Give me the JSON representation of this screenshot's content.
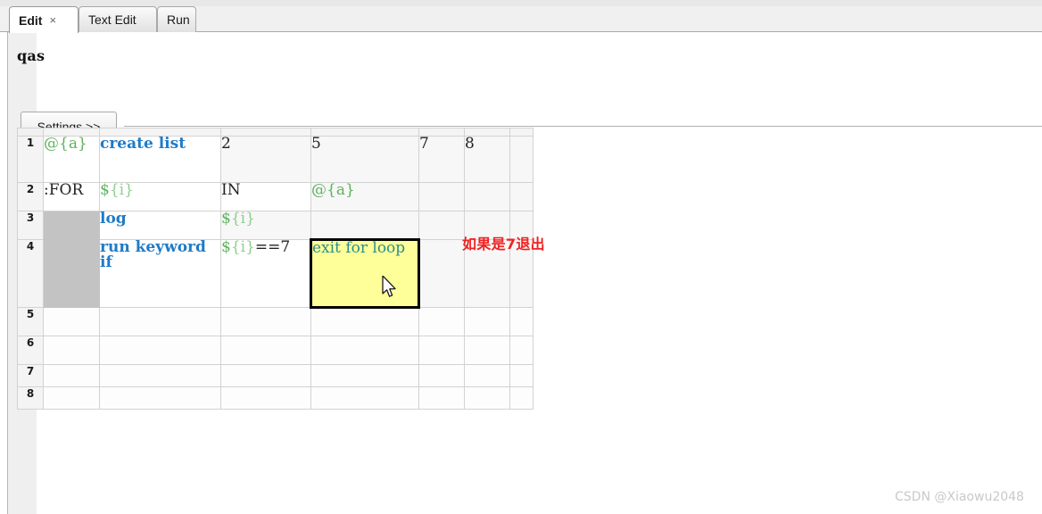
{
  "window": {
    "tabs": [
      {
        "label": "Edit",
        "active": true,
        "closable": true,
        "close_glyph": "×"
      },
      {
        "label": "Text Edit",
        "active": false,
        "closable": false
      },
      {
        "label": "Run",
        "active": false,
        "closable": false
      }
    ]
  },
  "editor": {
    "suite_title": "qas",
    "settings_button_label": "Settings >>"
  },
  "grid": {
    "row_numbers": [
      "1",
      "2",
      "3",
      "4",
      "5",
      "6",
      "7",
      "8"
    ],
    "rows": [
      {
        "number": "1",
        "cells": [
          {
            "text": "@{a}",
            "style": "var-at"
          },
          {
            "text": "create list",
            "style": "kw"
          },
          {
            "text": "2",
            "style": "plain"
          },
          {
            "text": "5",
            "style": "plain"
          },
          {
            "text": "7",
            "style": "plain"
          },
          {
            "text": "8",
            "style": "plain"
          },
          {
            "text": "",
            "style": "plain"
          }
        ]
      },
      {
        "number": "2",
        "cells": [
          {
            "text": ":FOR",
            "style": "plain"
          },
          {
            "text": "${i}",
            "style": "var"
          },
          {
            "text": "IN",
            "style": "plain"
          },
          {
            "text": "@{a}",
            "style": "var-at"
          },
          {
            "text": "",
            "style": "plain"
          },
          {
            "text": "",
            "style": "plain"
          },
          {
            "text": "",
            "style": "plain"
          }
        ]
      },
      {
        "number": "3",
        "cells": [
          {
            "text": "",
            "style": "forblock"
          },
          {
            "text": "log",
            "style": "kw"
          },
          {
            "text": "${i}",
            "style": "var"
          },
          {
            "text": "",
            "style": "plain"
          },
          {
            "text": "",
            "style": "plain"
          },
          {
            "text": "",
            "style": "plain"
          },
          {
            "text": "",
            "style": "plain"
          }
        ]
      },
      {
        "number": "4",
        "cells": [
          {
            "text": "",
            "style": "forblock"
          },
          {
            "text": "run keyword if",
            "style": "kw"
          },
          {
            "text": "${i}==7",
            "style": "var-expr"
          },
          {
            "text": "exit for loop",
            "style": "teal",
            "selected": true
          },
          {
            "text": "",
            "style": "plain"
          },
          {
            "text": "",
            "style": "plain"
          },
          {
            "text": "",
            "style": "plain"
          }
        ]
      },
      {
        "number": "5",
        "cells": [
          {
            "text": ""
          },
          {
            "text": ""
          },
          {
            "text": ""
          },
          {
            "text": ""
          },
          {
            "text": ""
          },
          {
            "text": ""
          },
          {
            "text": ""
          }
        ]
      },
      {
        "number": "6",
        "cells": [
          {
            "text": ""
          },
          {
            "text": ""
          },
          {
            "text": ""
          },
          {
            "text": ""
          },
          {
            "text": ""
          },
          {
            "text": ""
          },
          {
            "text": ""
          }
        ]
      },
      {
        "number": "7",
        "cells": [
          {
            "text": ""
          },
          {
            "text": ""
          },
          {
            "text": ""
          },
          {
            "text": ""
          },
          {
            "text": ""
          },
          {
            "text": ""
          },
          {
            "text": ""
          }
        ]
      },
      {
        "number": "8",
        "cells": [
          {
            "text": ""
          },
          {
            "text": ""
          },
          {
            "text": ""
          },
          {
            "text": ""
          },
          {
            "text": ""
          },
          {
            "text": ""
          },
          {
            "text": ""
          }
        ]
      }
    ]
  },
  "annotation": {
    "text": "如果是7退出",
    "color": "#ef2222"
  },
  "watermark": {
    "text": "CSDN @Xiaowu2048"
  },
  "colors": {
    "keyword_blue": "#1f7bc7",
    "variable_green": "#5bb35b",
    "selected_cell_bg": "#ffff99",
    "for_block_gray": "#c3c3c3",
    "annotation_red": "#ef2222"
  }
}
